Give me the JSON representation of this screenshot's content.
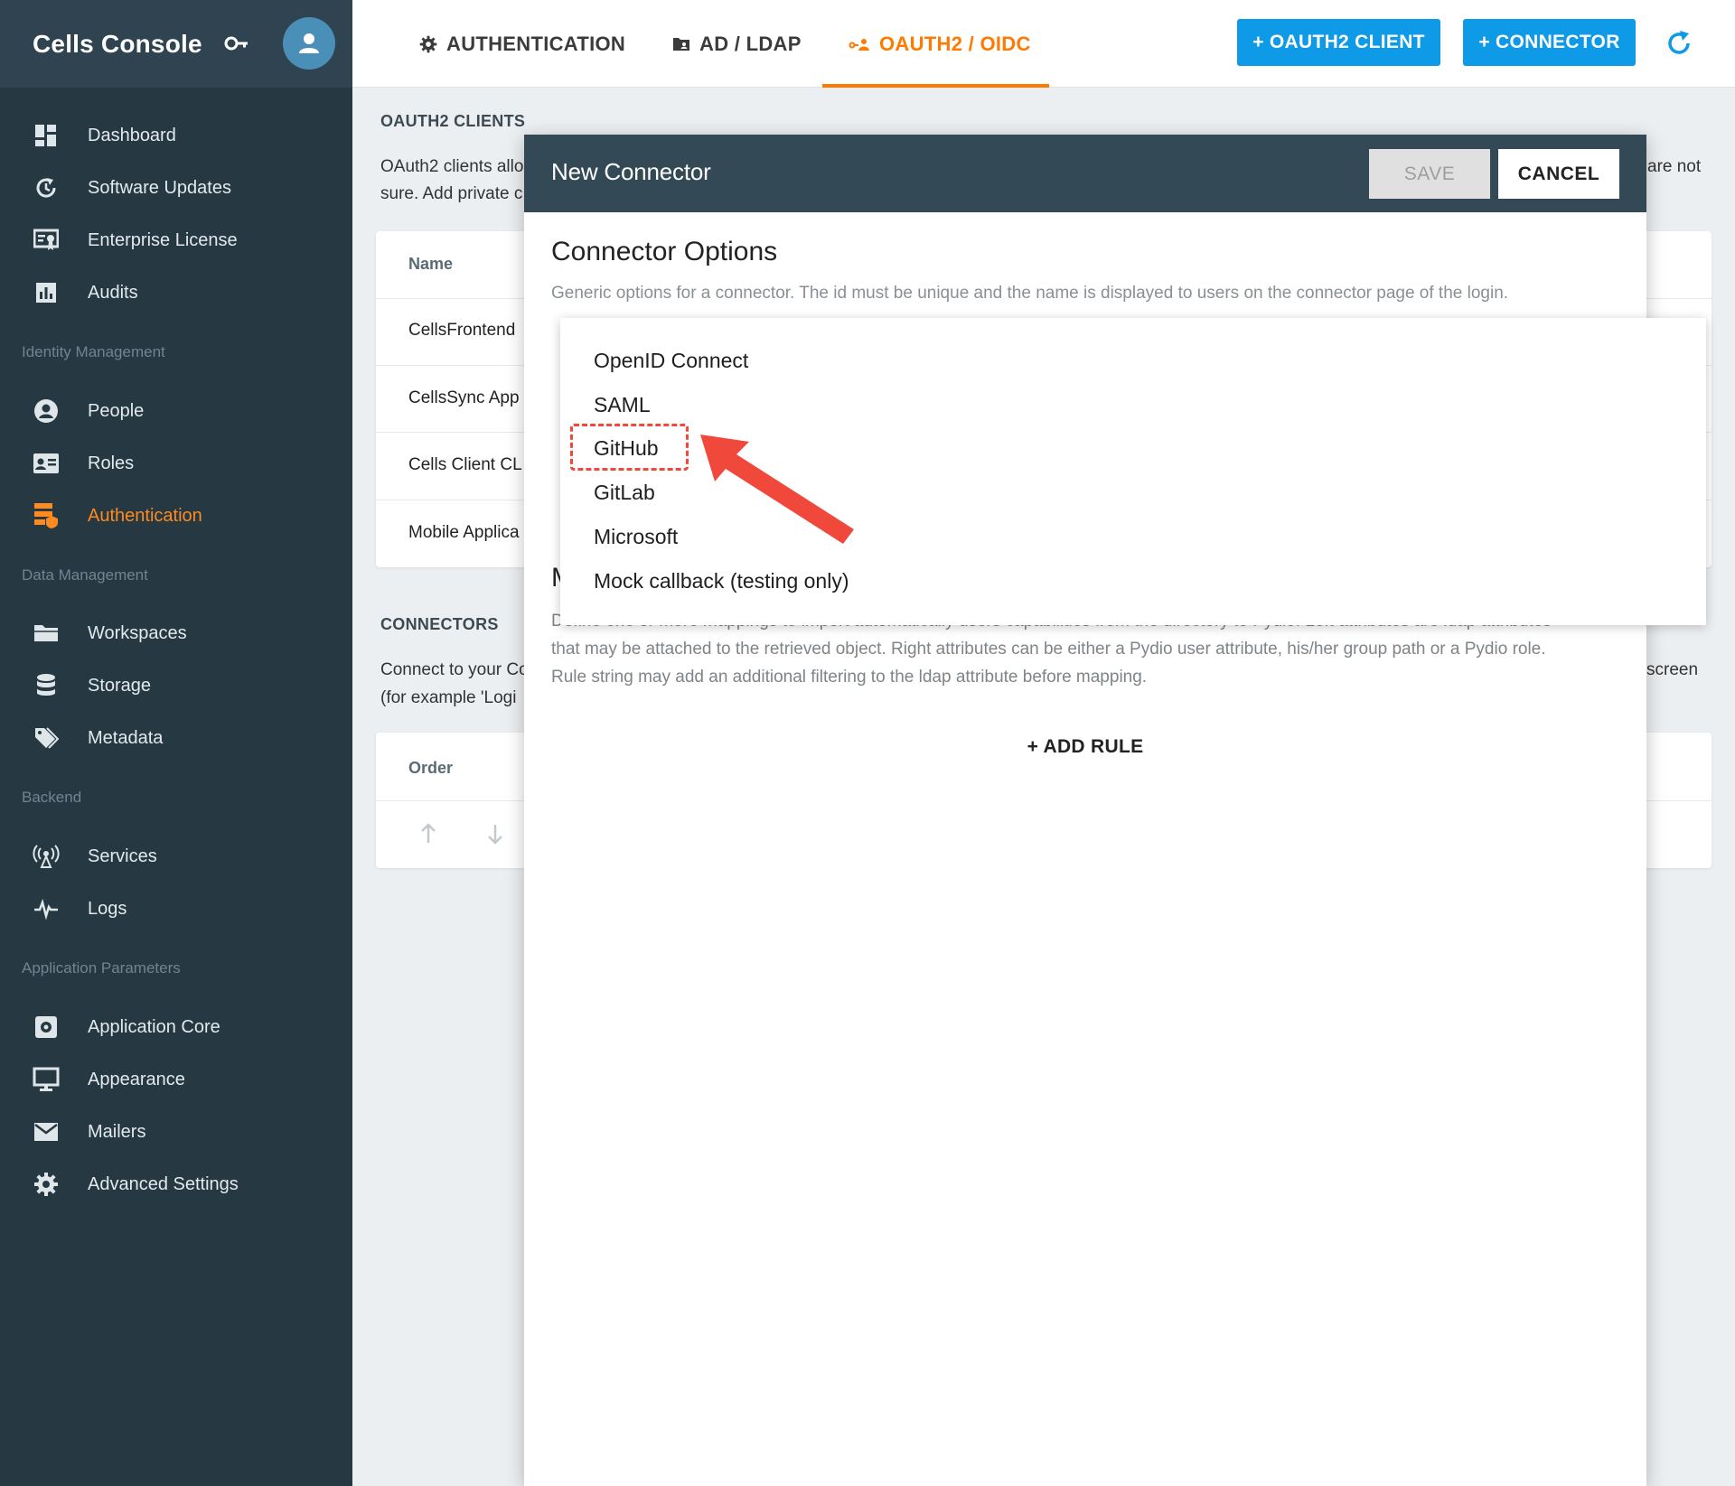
{
  "app": {
    "title": "Cells Console"
  },
  "sidebar": {
    "top_items": [
      {
        "label": "Dashboard",
        "icon": "dashboard-icon"
      },
      {
        "label": "Software Updates",
        "icon": "update-icon"
      },
      {
        "label": "Enterprise License",
        "icon": "license-icon"
      },
      {
        "label": "Audits",
        "icon": "chart-icon"
      }
    ],
    "sections": [
      {
        "title": "Identity Management",
        "items": [
          {
            "label": "People",
            "icon": "person-icon"
          },
          {
            "label": "Roles",
            "icon": "id-card-icon"
          },
          {
            "label": "Authentication",
            "icon": "security-icon",
            "active": true
          }
        ]
      },
      {
        "title": "Data Management",
        "items": [
          {
            "label": "Workspaces",
            "icon": "folder-icon"
          },
          {
            "label": "Storage",
            "icon": "database-icon"
          },
          {
            "label": "Metadata",
            "icon": "tag-icon"
          }
        ]
      },
      {
        "title": "Backend",
        "items": [
          {
            "label": "Services",
            "icon": "antenna-icon"
          },
          {
            "label": "Logs",
            "icon": "pulse-icon"
          }
        ]
      },
      {
        "title": "Application Parameters",
        "items": [
          {
            "label": "Application Core",
            "icon": "settings-box-icon"
          },
          {
            "label": "Appearance",
            "icon": "monitor-icon"
          },
          {
            "label": "Mailers",
            "icon": "mail-icon"
          },
          {
            "label": "Advanced Settings",
            "icon": "gear-icon"
          }
        ]
      }
    ]
  },
  "topbar": {
    "tabs": [
      {
        "label": "AUTHENTICATION",
        "icon": "gear-icon"
      },
      {
        "label": "AD / LDAP",
        "icon": "folder-account-icon"
      },
      {
        "label": "OAUTH2 / OIDC",
        "icon": "key-user-icon",
        "active": true
      }
    ],
    "buttons": [
      "+ OAUTH2 CLIENT",
      "+ CONNECTOR"
    ],
    "accent_color": "#ff7a00",
    "primary_color": "#0f9ae8"
  },
  "background": {
    "clients_heading": "OAUTH2 CLIENTS",
    "clients_desc_line1": "OAuth2 clients allo",
    "clients_desc_line1_right": "are not",
    "clients_desc_line2": "sure. Add private c",
    "clients_col_name": "Name",
    "clients_rows": [
      "CellsFrontend",
      "CellsSync App",
      "Cells Client CL",
      "Mobile Applica"
    ],
    "connectors_heading": "CONNECTORS",
    "connectors_desc_line1": "Connect to your Co",
    "connectors_desc_line1_right": "screen",
    "connectors_desc_line2": "(for example 'Logi",
    "connectors_col_order": "Order"
  },
  "modal": {
    "title": "New Connector",
    "save_label": "SAVE",
    "cancel_label": "CANCEL",
    "section_title": "Connector Options",
    "section_desc": "Generic options for a connector. The id must be unique and the name is displayed to users on the connector page of the login.",
    "mapping_letter": "M",
    "mapping_desc_line1": "Define one or more mappings to import automatically users capabilities from the directory to Pydio. Left attributes are ldap attributes",
    "mapping_desc_line2": "that may be attached to the retrieved object. Right attributes can be either a Pydio user attribute, his/her group path or a Pydio role.",
    "mapping_desc_line3": "Rule string may add an additional filtering to the ldap attribute before mapping.",
    "add_rule_label": "+ ADD RULE"
  },
  "dropdown": {
    "options": [
      "OpenID Connect",
      "SAML",
      "GitHub",
      "GitLab",
      "Microsoft",
      "Mock callback (testing only)"
    ],
    "highlighted": "GitHub",
    "highlight_color": "#f0493c"
  }
}
